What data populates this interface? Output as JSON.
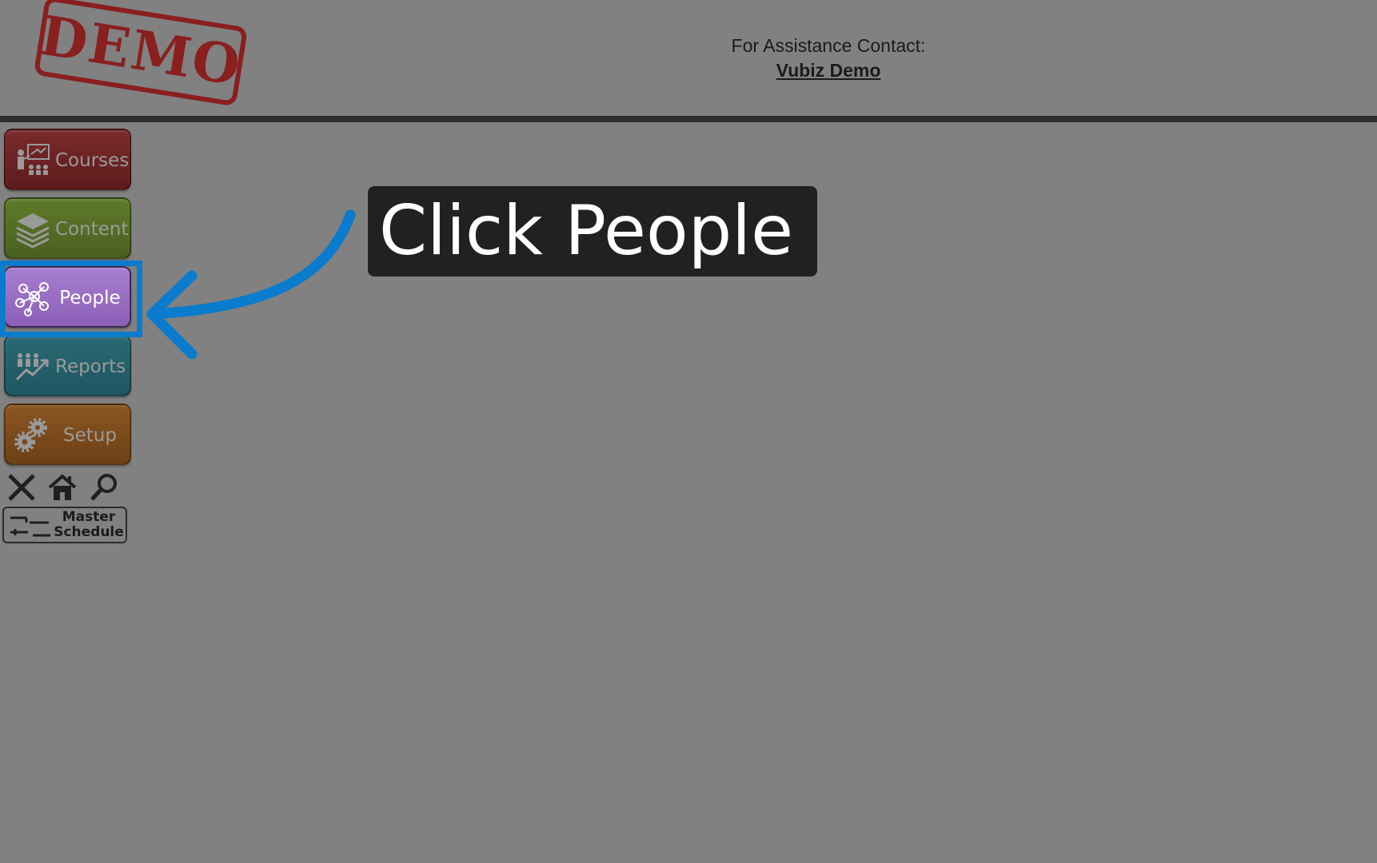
{
  "header": {
    "stamp_text": "DEMO",
    "assist_label": "For Assistance Contact:",
    "assist_link": "Vubiz Demo"
  },
  "nav": {
    "items": [
      {
        "label": "Courses",
        "icon": "classroom-icon",
        "color": "#6b2222"
      },
      {
        "label": "Content",
        "icon": "layers-icon",
        "color": "#566d25"
      },
      {
        "label": "People",
        "icon": "network-people-icon",
        "color": "#9a6fc4"
      },
      {
        "label": "Reports",
        "icon": "chart-people-icon",
        "color": "#24606a"
      },
      {
        "label": "Setup",
        "icon": "gears-icon",
        "color": "#7c4a1b"
      }
    ]
  },
  "tools": {
    "close_icon": "close-icon",
    "home_icon": "home-icon",
    "search_icon": "search-icon",
    "master_line1": "Master",
    "master_line2": "Schedule"
  },
  "callout": {
    "text": "Click People",
    "highlight_color": "#0a7bcd"
  }
}
